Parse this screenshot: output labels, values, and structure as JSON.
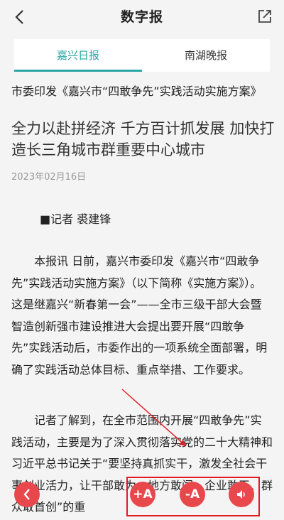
{
  "header": {
    "title": "数字报",
    "back_icon": "chevron-left-icon",
    "share_icon": "share-icon"
  },
  "tabs": [
    {
      "label": "嘉兴日报",
      "active": true
    },
    {
      "label": "南湖晚报",
      "active": false
    }
  ],
  "article": {
    "pre_title": "市委印发《嘉兴市“四敢争先”实践活动实施方案》",
    "title": "全力以赴拼经济 千方百计抓发展 加快打造长三角城市群重要中心城市",
    "date": "2023年02月16日",
    "byline": "■记者 裘建锋",
    "paragraphs": [
      "本报讯 日前，嘉兴市委印发《嘉兴市“四敢争先”实践活动实施方案》（以下简称《实施方案》）。这是继嘉兴“新春第一会”——全市三级干部大会暨智造创新强市建设推进大会提出要开展“四敢争先”实践活动后，市委作出的一项系统全面部署，明确了实践活动总体目标、重点举措、工作要求。",
      "记者了解到，在全市范围内开展“四敢争先”实践活动，主要是为了深入贯彻落实党的二十大精神和习近平总书记关于“要坚持真抓实干，激发全社会干事创业活力，让干部敢为、地方敢闯、企业敢干、群众敢首创”的重"
    ]
  },
  "bottom_bar": {
    "back_icon": "chevron-left-icon",
    "font_up_label": "+A",
    "font_down_label": "-A",
    "audio_icon": "speaker-icon"
  },
  "colors": {
    "accent": "#2aa7a5",
    "button": "#e8474b",
    "highlight": "#e21c23"
  }
}
